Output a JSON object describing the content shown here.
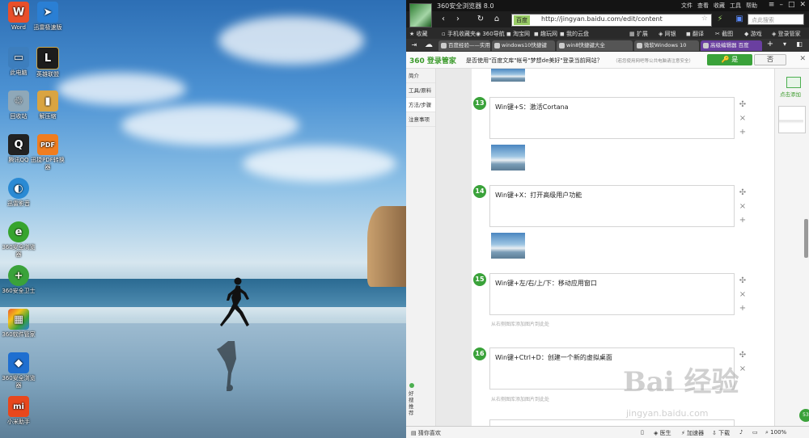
{
  "desktop": {
    "icons": [
      {
        "label": "Word",
        "glyph": "W",
        "color": "#e94f2a"
      },
      {
        "label": "迅雷极速版",
        "glyph": "➤",
        "color": "#2a7fd4"
      },
      {
        "label": "此电脑",
        "glyph": "▭",
        "color": "#3d7ebd"
      },
      {
        "label": "英雄联盟",
        "glyph": "L",
        "color": "#1c1c1c"
      },
      {
        "label": "回收站",
        "glyph": "♲",
        "color": "#9ab"
      },
      {
        "label": "解压缩",
        "glyph": "▮",
        "color": "#d9a441"
      },
      {
        "label": "腾讯QQ",
        "glyph": "Q",
        "color": "#111"
      },
      {
        "label": "迅捷PDF转换器",
        "glyph": "PDF",
        "color": "#f07d1f"
      },
      {
        "label": "迅雷影音",
        "glyph": "◐",
        "color": "#2a8ad4"
      },
      {
        "label": "360安全浏览器",
        "glyph": "e",
        "color": "#37a42e"
      },
      {
        "label": "360安全卫士",
        "glyph": "+",
        "color": "#3aa23a"
      },
      {
        "label": "360软件管家",
        "glyph": "▦",
        "color": "#e85b2a"
      },
      {
        "label": "360安全浏览器",
        "glyph": "◆",
        "color": "#1f6fd0"
      },
      {
        "label": "小米助手",
        "glyph": "mi",
        "color": "#e8471c"
      }
    ]
  },
  "browser": {
    "app_title": "360安全浏览器 8.0",
    "menu": [
      "文件",
      "查看",
      "收藏",
      "工具",
      "帮助"
    ],
    "address": {
      "tag": "百度",
      "url": "http://jingyan.baidu.com/edit/content"
    },
    "search_placeholder": "点此搜索",
    "favorites": [
      {
        "label": "收藏"
      },
      {
        "label": "手机收藏夹"
      },
      {
        "label": "360导航"
      },
      {
        "label": "淘宝网"
      },
      {
        "label": "趣玩网"
      },
      {
        "label": "我的云盘"
      },
      {
        "label": "扩展"
      },
      {
        "label": "网银"
      },
      {
        "label": "翻译"
      },
      {
        "label": "截图"
      },
      {
        "label": "游戏"
      },
      {
        "label": "登录管家"
      }
    ],
    "tabs": [
      {
        "label": "百度经验——实用"
      },
      {
        "label": "windows10快捷键"
      },
      {
        "label": "win8快捷键大全"
      },
      {
        "label": "微软Windows 10"
      },
      {
        "label": "高级编辑器 百度"
      }
    ],
    "notify": {
      "brand": "360 登录管家",
      "question": "是否使用\"百度文库\"帐号\"梦想de美好\"登录当前网站？",
      "hint": "（若您使用网吧等公共电脑请注意安全）",
      "yes_label": "是",
      "no_label": "否"
    },
    "sidebar": {
      "items": [
        "简介",
        "工具/原料",
        "方法/步骤",
        "注意事项"
      ],
      "bottom_label": "好搜推荐"
    },
    "right_rail": {
      "add_label": "点击添加"
    },
    "steps": [
      {
        "num": "13",
        "text": "Win键+S：激活Cortana",
        "upload": ""
      },
      {
        "num": "14",
        "text": "Win键+X：打开高级用户功能",
        "upload": ""
      },
      {
        "num": "15",
        "text": "Win键+左/右/上/下：移动应用窗口",
        "upload": "从右侧图库添加图片到此处"
      },
      {
        "num": "16",
        "text": "Win键+Ctrl+D：创建一个新的虚拟桌面",
        "upload": "从右侧图库添加图片到此处"
      }
    ],
    "watermark": {
      "big": "Bai 经验",
      "small": "jingyan.baidu.com"
    },
    "status": {
      "left": "猜你喜欢",
      "items": [
        "医生",
        "加速器",
        "下载",
        "100%"
      ]
    },
    "badge": "53"
  }
}
